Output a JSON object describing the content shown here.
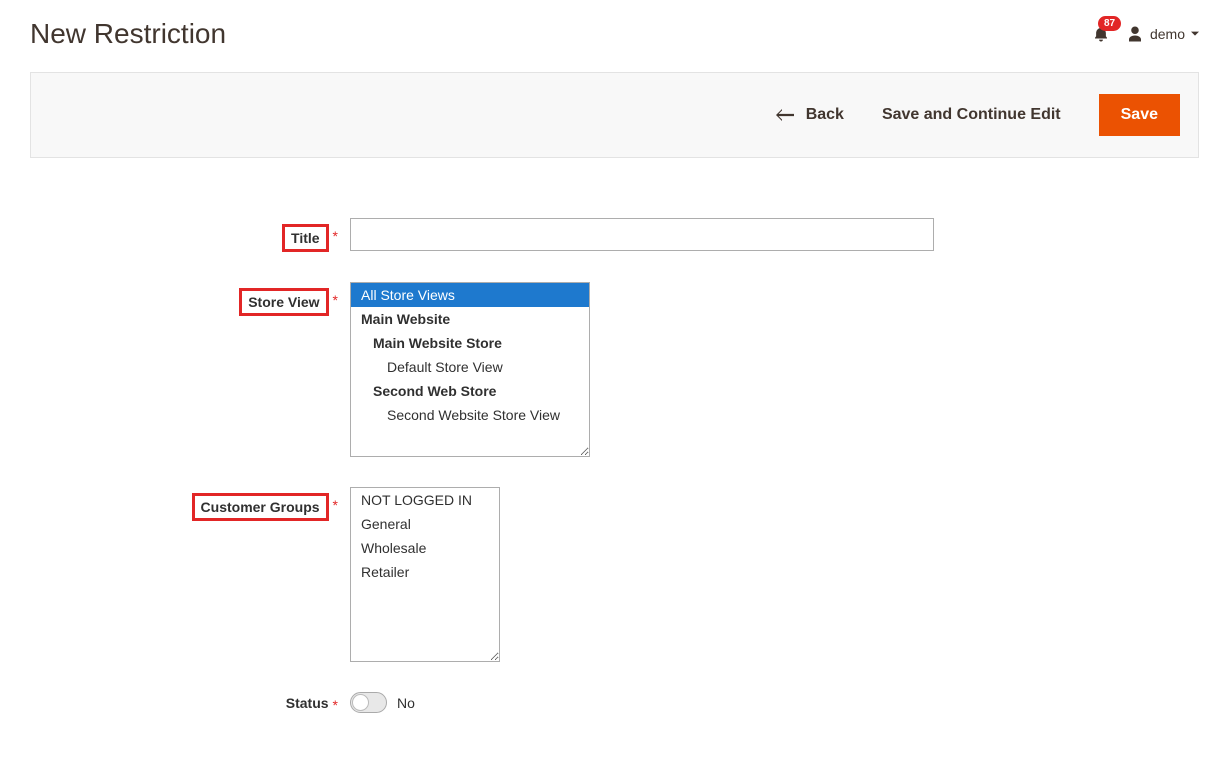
{
  "header": {
    "page_title": "New Restriction",
    "notification_count": "87",
    "username": "demo"
  },
  "actions": {
    "back_label": "Back",
    "save_continue_label": "Save and Continue Edit",
    "save_label": "Save"
  },
  "form": {
    "title": {
      "label": "Title",
      "value": ""
    },
    "store_view": {
      "label": "Store View",
      "options": [
        {
          "text": "All Store Views",
          "selected": true,
          "bold": false,
          "indent": 0
        },
        {
          "text": "Main Website",
          "selected": false,
          "bold": true,
          "indent": 0
        },
        {
          "text": "Main Website Store",
          "selected": false,
          "bold": true,
          "indent": 1
        },
        {
          "text": "Default Store View",
          "selected": false,
          "bold": false,
          "indent": 2
        },
        {
          "text": "Second Web Store",
          "selected": false,
          "bold": true,
          "indent": 1
        },
        {
          "text": "Second Website Store View",
          "selected": false,
          "bold": false,
          "indent": 2
        }
      ]
    },
    "customer_groups": {
      "label": "Customer Groups",
      "options": [
        {
          "text": "NOT LOGGED IN"
        },
        {
          "text": "General"
        },
        {
          "text": "Wholesale"
        },
        {
          "text": "Retailer"
        }
      ]
    },
    "status": {
      "label": "Status",
      "value_label": "No",
      "on": false
    }
  }
}
